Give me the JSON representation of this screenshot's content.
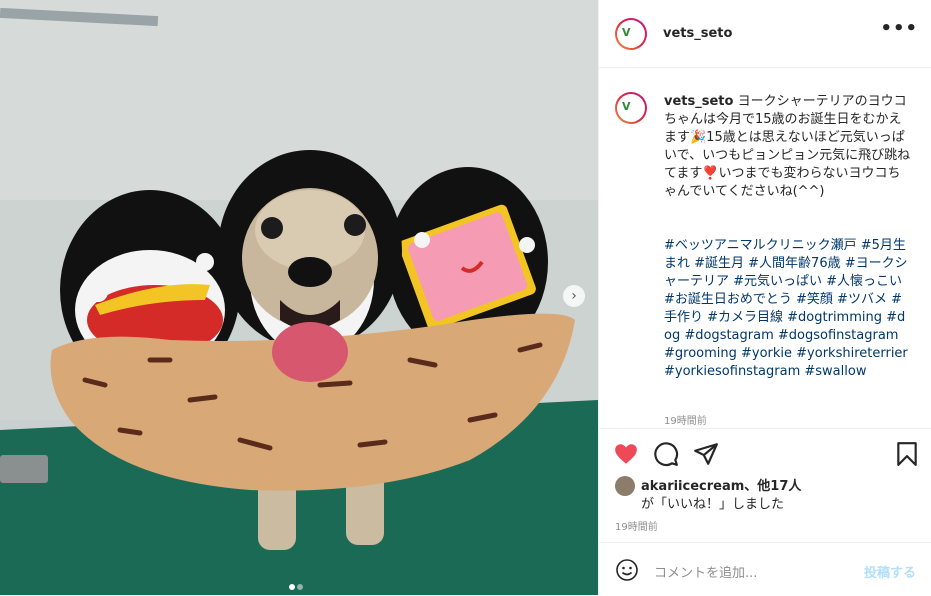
{
  "post": {
    "username": "vets_seto",
    "more_label": "•••",
    "caption_text": "ヨークシャーテリアのヨウコちゃんは今月で15歳のお誕生日をむかえます🎉15歳とは思えないほど元気いっぱいで、いつもピョンピョン元気に飛び跳ねてます❣️いつまでも変わらないヨウコちゃんでいてくださいね(^^)",
    "hashtags": "#ベッツアニマルクリニック瀬戸 #5月生まれ #誕生月 #人間年齢76歳 #ヨークシャーテリア #元気いっぱい #人懐っこい #お誕生日おめでとう #笑顔 #ツバメ #手作り #カメラ目線 #dogtrimming #dog #dogstagram #dogsofinstagram #grooming #yorkie #yorkshireterrier #yorkiesofinstagram #swallow",
    "caption_time": "19時間前",
    "likes_user": "akariicecream",
    "likes_rest": "、他17人",
    "likes_line2": "が「いいね！」しました",
    "post_time": "19時間前",
    "comment_placeholder": "コメントを追加...",
    "post_button": "投稿する"
  },
  "icons": {
    "heart": "heart-icon",
    "comment": "comment-icon",
    "share": "share-icon",
    "bookmark": "bookmark-icon",
    "emoji": "emoji-icon",
    "next": "chevron-right-icon"
  },
  "colors": {
    "like": "#ed4956",
    "hashtag": "#00376b",
    "post_button": "#b2dffc",
    "meta": "#8e8e8e"
  },
  "carousel": {
    "current": 1,
    "total": 2
  }
}
